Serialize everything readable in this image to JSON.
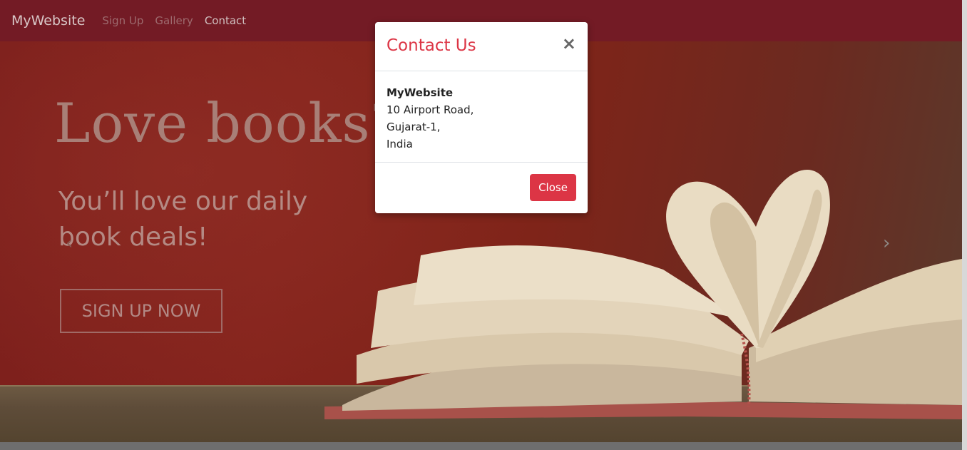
{
  "navbar": {
    "brand": "MyWebsite",
    "links": [
      "Sign Up",
      "Gallery",
      "Contact"
    ]
  },
  "hero": {
    "title": "Love books?",
    "subtitle": "You’ll love our daily book deals!",
    "cta": "SIGN UP NOW",
    "prev_icon": "‹",
    "next_icon": "›"
  },
  "modal": {
    "title": "Contact Us",
    "close_symbol": "×",
    "company": "MyWebsite",
    "address_lines": [
      "10 Airport Road,",
      "Gujarat-1,",
      "India"
    ],
    "close_button": "Close"
  },
  "colors": {
    "brand": "#731b25",
    "accent": "#dc3545"
  }
}
